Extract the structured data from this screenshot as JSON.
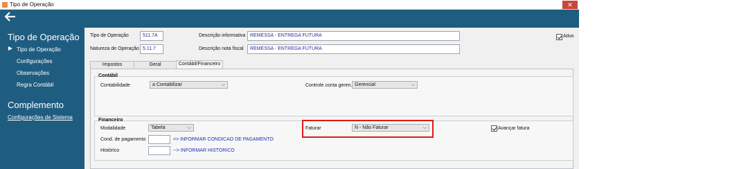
{
  "window": {
    "title": "Tipo de Operação",
    "close_symbol": "✕"
  },
  "topbar": {
    "back_symbol": "🡐"
  },
  "sidebar": {
    "section1_title": "Tipo de Operação",
    "items": [
      {
        "label": "Tipo de Operação",
        "active": true
      },
      {
        "label": "Configurações"
      },
      {
        "label": "Observações"
      },
      {
        "label": "Regra Contábil"
      }
    ],
    "section2_title": "Complemento",
    "link": "Configurações de Sistema"
  },
  "header": {
    "tipo_label": "Tipo de Operação",
    "tipo_value": "511.7A",
    "natureza_label": "Natureza de Operação",
    "natureza_value": "5.11.7",
    "desc_info_label": "Descrição informativa",
    "desc_info_value": "REMESSA - ENTREGA FUTURA",
    "desc_nota_label": "Descrição nota fiscal",
    "desc_nota_value": "REMESSA - ENTREGA FUTURA",
    "ativo_label": "Ativo",
    "ativo_checked": true
  },
  "tabs": [
    {
      "label": "Impostos"
    },
    {
      "label": "Geral"
    },
    {
      "label": "Contábil/Financeiro",
      "active": true
    }
  ],
  "contabil": {
    "title": "Contábil",
    "contabilidade_label": "Contabilidade",
    "contabilidade_value": "a Contabilizar",
    "controle_label": "Controle conta geren.",
    "controle_value": "Gerencial"
  },
  "financeiro": {
    "title": "Financeiro",
    "modalidade_label": "Modalidade",
    "modalidade_value": "Tabela",
    "faturar_label": "Faturar",
    "faturar_value": "N - Não Faturar",
    "avancar_label": "Avançar fatura",
    "avancar_checked": true,
    "cond_label": "Cond. de pagamento",
    "cond_link": "=> INFORMAR CONDICAO DE PAGAMENTO",
    "historico_label": "Histórico",
    "historico_link": "--> INFORMAR HISTORICO"
  },
  "colors": {
    "sidebar_bg": "#1f5d80",
    "highlight": "#e01818",
    "link": "#1c2fb0"
  }
}
